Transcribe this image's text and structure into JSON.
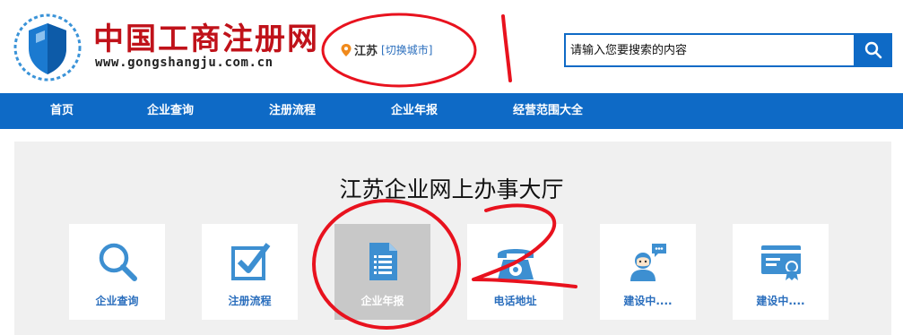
{
  "header": {
    "logo_title": "中国工商注册网",
    "logo_url": "www.gongshangju.com.cn",
    "city": "江苏",
    "switch_city": "[切换城市]",
    "search_placeholder": "请输入您要搜索的内容"
  },
  "nav": {
    "items": [
      {
        "label": "首页"
      },
      {
        "label": "企业查询"
      },
      {
        "label": "注册流程"
      },
      {
        "label": "企业年报"
      },
      {
        "label": "经营范围大全"
      }
    ]
  },
  "hall": {
    "title": "江苏企业网上办事大厅",
    "cards": [
      {
        "label": "企业查询",
        "icon": "search-icon"
      },
      {
        "label": "注册流程",
        "icon": "checkbox-icon"
      },
      {
        "label": "企业年报",
        "icon": "document-icon",
        "active": true
      },
      {
        "label": "电话地址",
        "icon": "phone-icon"
      },
      {
        "label": "建设中....",
        "icon": "support-agent-icon"
      },
      {
        "label": "建设中....",
        "icon": "certificate-icon"
      }
    ]
  },
  "colors": {
    "brand_blue": "#0e6ac6",
    "logo_red": "#c0121a",
    "link_blue": "#2a6ebd",
    "annotation_red": "#e8121e"
  }
}
